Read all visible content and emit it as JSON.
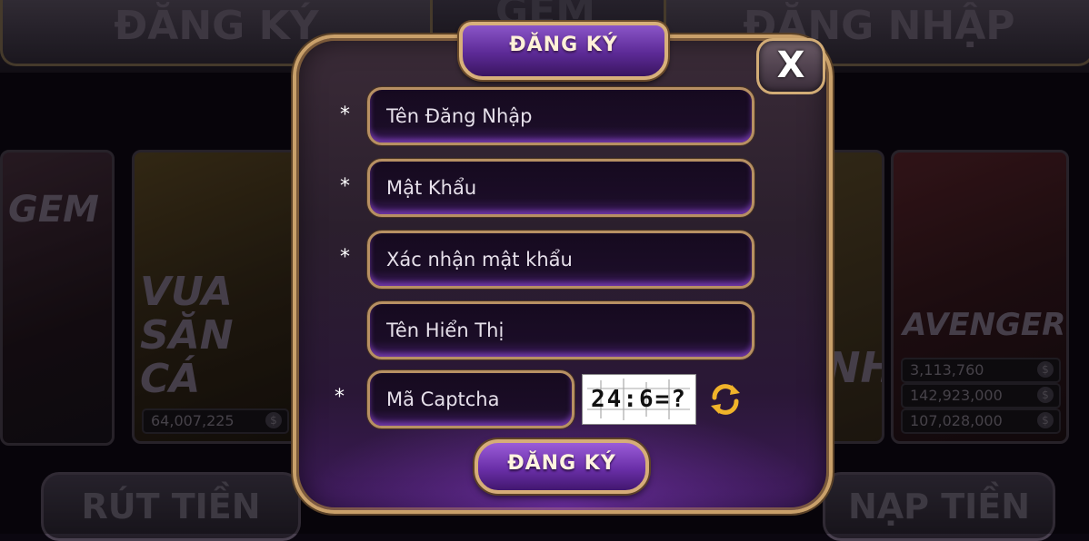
{
  "background": {
    "top_left_button": "ĐĂNG KÝ",
    "top_center_logo": "GEM",
    "top_right_button": "ĐĂNG NHẬP",
    "card_1_title": "GEM",
    "card_2_title": "VUA SĂN CÁ",
    "card_2_jackpot": "64,007,225",
    "card_3_title": "NH",
    "card_4_title": "AVENGERS",
    "card_4_jackpots": [
      "3,113,760",
      "142,923,000",
      "107,028,000"
    ],
    "bottom_left_button": "RÚT TIỀN",
    "bottom_right_button": "NẠP TIỀN"
  },
  "modal": {
    "title": "ĐĂNG KÝ",
    "close_label": "X",
    "required_marker": "*",
    "fields": {
      "username_placeholder": "Tên Đăng Nhập",
      "password_placeholder": "Mật Khẩu",
      "confirm_password_placeholder": "Xác nhận mật khẩu",
      "display_name_placeholder": "Tên Hiển Thị",
      "captcha_placeholder": "Mã Captcha"
    },
    "captcha_text": "24:6=?",
    "refresh_icon": "refresh-icon",
    "submit_label": "ĐĂNG KÝ"
  },
  "colors": {
    "accent_purple": "#6a2fa8",
    "gold_border": "#c9a06a",
    "refresh_gold": "#f0b32a"
  }
}
